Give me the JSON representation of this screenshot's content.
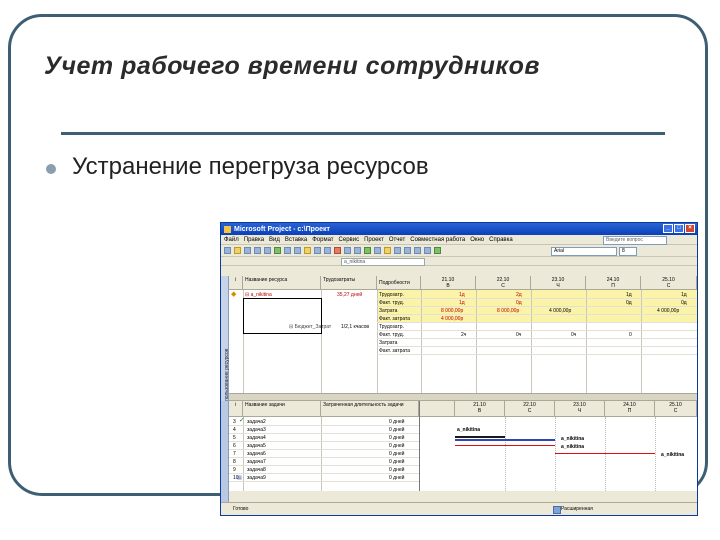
{
  "slide": {
    "title": "Учет рабочего времени сотрудников",
    "bullet": "Устранение перегруза ресурсов"
  },
  "window": {
    "title": "Microsoft Project - с:\\Проект",
    "menu": [
      "Файл",
      "Правка",
      "Вид",
      "Вставка",
      "Формат",
      "Сервис",
      "Проект",
      "Отчет",
      "Совместная работа",
      "Окно",
      "Справка"
    ],
    "help_placeholder": "Введите вопрос",
    "font": "Arial",
    "font_size": "8",
    "filter": "a_nikitina",
    "view_label": "Использование ресурсов"
  },
  "resource_usage": {
    "headers": {
      "info": "i",
      "name": "Название ресурса",
      "work": "Трудозатраты",
      "details": "Подробности"
    },
    "resources": [
      {
        "name": "a_nikitina",
        "work": "35,27 дней"
      },
      {
        "name": "Бюджет_Затрат"
      }
    ],
    "resource2_work": "1/2,1 кчасов",
    "detail_rows": [
      "Трудозатр.",
      "Факт. труд.",
      "Затрата",
      "Факт. затрата",
      "Трудозатр.",
      "Факт. труд.",
      "Затрата",
      "Факт. затрата"
    ],
    "timescale": [
      {
        "date": "21.10",
        "day": "В"
      },
      {
        "date": "22.10",
        "day": "С"
      },
      {
        "date": "23.10",
        "day": "Ч"
      },
      {
        "date": "24.10",
        "day": "П"
      },
      {
        "date": "25.10",
        "day": "С"
      }
    ],
    "values_row1": [
      "1д",
      "2д",
      "1д",
      "1д"
    ],
    "values_row2": [
      "1д",
      "0д",
      "0д",
      "0д"
    ],
    "values_row3": [
      "8 000,00р",
      "8 000,00р",
      "4 000,00р",
      "4 000,00р"
    ],
    "values_row4": [
      "4 000,00р"
    ],
    "values_row5": [
      "2ч",
      "0ч",
      "0ч",
      "0"
    ]
  },
  "tasks": {
    "headers": {
      "info": "i",
      "name": "Название задачи",
      "duration": "Затраченная длительность задачи"
    },
    "rows": [
      {
        "id": "3",
        "name": "задача2",
        "dur": "0 дней"
      },
      {
        "id": "4",
        "name": "задача3",
        "dur": "0 дней"
      },
      {
        "id": "5",
        "name": "задача4",
        "dur": "0 дней"
      },
      {
        "id": "6",
        "name": "задача5",
        "dur": "0 дней"
      },
      {
        "id": "7",
        "name": "задача6",
        "dur": "0 дней"
      },
      {
        "id": "8",
        "name": "задача7",
        "dur": "0 дней"
      },
      {
        "id": "9",
        "name": "задача8",
        "dur": "0 дней"
      },
      {
        "id": "10",
        "name": "задача9",
        "dur": "0 дней"
      }
    ],
    "gantt_labels": [
      "a_nikitina",
      "a_nikitina",
      "a_nikitina",
      "a_nikitina"
    ]
  },
  "status": {
    "left": "Готово",
    "right": "Расширенная"
  },
  "colors": {
    "frame": "#3e5f73",
    "highlight": "#fbf3a8",
    "overalloc": "#c00000"
  }
}
